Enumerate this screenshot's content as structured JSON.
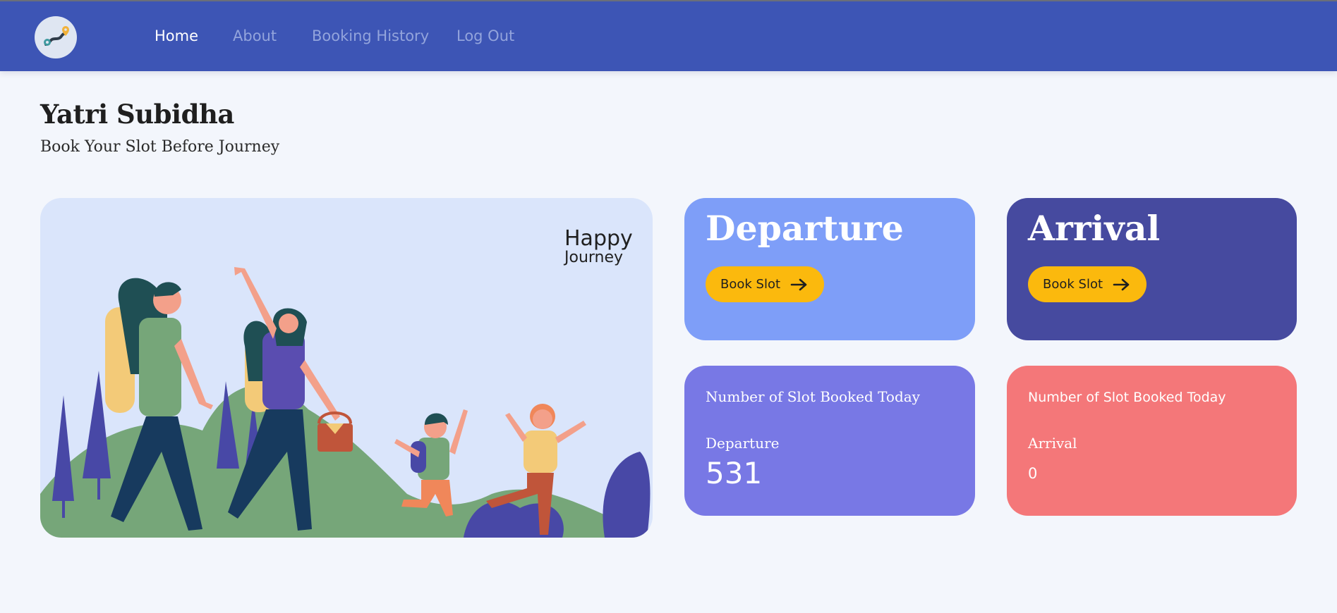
{
  "nav": {
    "items": [
      {
        "label": "Home",
        "active": true
      },
      {
        "label": "About",
        "active": false
      },
      {
        "label": "Booking History",
        "active": false
      },
      {
        "label": "Log Out",
        "active": false
      }
    ],
    "logo_icon": "route-map-pin-icon"
  },
  "header": {
    "title": "Yatri Subidha",
    "subtitle": "Book Your Slot Before Journey"
  },
  "hero": {
    "line1": "Happy",
    "line2": "Journey",
    "illustration": "family-hiking-illustration"
  },
  "departure_card": {
    "title": "Departure",
    "button_label": "Book Slot",
    "button_icon": "arrow-right-icon"
  },
  "arrival_card": {
    "title": "Arrival",
    "button_label": "Book Slot",
    "button_icon": "arrow-right-icon"
  },
  "departure_count": {
    "heading": "Number of Slot Booked Today",
    "label": "Departure",
    "value": "531"
  },
  "arrival_count": {
    "heading": "Number of Slot Booked Today",
    "label": "Arrival",
    "value": "0"
  },
  "colors": {
    "navbar": "#3d55b5",
    "departure_card": "#7e9ef8",
    "arrival_card": "#464a9f",
    "departure_count_card": "#7878e5",
    "arrival_count_card": "#f47779",
    "button": "#fbb90d",
    "hero_background": "#dae5fb"
  }
}
